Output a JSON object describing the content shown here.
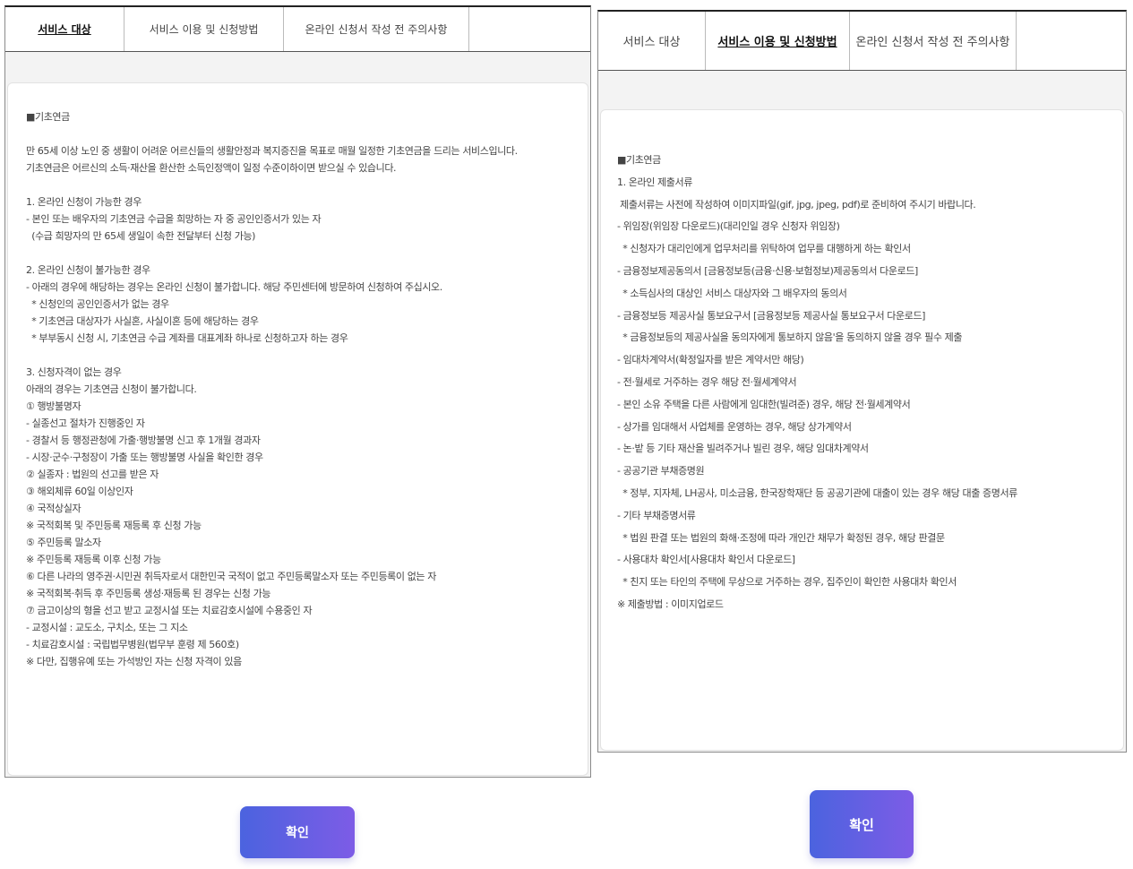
{
  "colors": {
    "accent_start": "#4b63df",
    "accent_end": "#7d5ce6",
    "text": "#444444"
  },
  "tabs": [
    "서비스 대상",
    "서비스 이용 및 신청방법",
    "온라인 신청서 작성 전 주의사항"
  ],
  "left": {
    "active_tab": "서비스 대상",
    "content_lines": [
      "■기초연금",
      "",
      "만 65세 이상 노인 중 생활이 어려운 어르신들의 생활안정과 복지증진을 목표로 매월 일정한 기초연금을 드리는 서비스입니다.",
      "기초연금은 어르신의 소득·재산을 환산한 소득인정액이 일정 수준이하이면 받으실 수 있습니다.",
      "",
      "1. 온라인 신청이 가능한 경우",
      "- 본인 또는 배우자의 기초연금 수급을 희망하는 자 중 공인인증서가 있는 자",
      "  (수급 희망자의 만 65세 생일이 속한 전달부터 신청 가능)",
      "",
      "2. 온라인 신청이 불가능한 경우",
      "- 아래의 경우에 해당하는 경우는 온라인 신청이 불가합니다. 해당 주민센터에 방문하여 신청하여 주십시오.",
      "  * 신청인의 공인인증서가 없는 경우",
      "  * 기초연금 대상자가 사실혼, 사실이혼 등에 해당하는 경우",
      "  * 부부동시 신청 시, 기초연금 수급 계좌를 대표계좌 하나로 신청하고자 하는 경우",
      "",
      "3. 신청자격이 없는 경우",
      "아래의 경우는 기초연금 신청이 불가합니다.",
      "① 행방불명자",
      "- 실종선고 절차가 진행중인 자",
      "- 경찰서 등 행정관청에 가출·행방불명 신고 후 1개월 경과자",
      "- 시장·군수·구청장이 가출 또는 행방불명 사실을 확인한 경우",
      "② 실종자 : 법원의 선고를 받은 자",
      "③ 해외체류 60일 이상인자",
      "④ 국적상실자",
      "※ 국적회복 및 주민등록 재등록 후 신청 가능",
      "⑤ 주민등록 말소자",
      "※ 주민등록 재등록 이후 신청 가능",
      "⑥ 다른 나라의 영주권·시민권 취득자로서 대한민국 국적이 없고 주민등록말소자 또는 주민등록이 없는 자",
      "※ 국적회복·취득 후 주민등록 생성·재등록 된 경우는 신청 가능",
      "⑦ 금고이상의 형을 선고 받고 교정시설 또는 치료감호시설에 수용중인 자",
      "- 교정시설 : 교도소, 구치소, 또는 그 지소",
      "- 치료감호시설 : 국립법무병원(법무부 훈령 제 560호)",
      "※ 다만, 집행유예 또는 가석방인 자는 신청 자격이 있음"
    ],
    "confirm_label": "확인"
  },
  "right": {
    "active_tab": "서비스 이용 및 신청방법",
    "content_lines": [
      "■기초연금",
      "1. 온라인 제출서류",
      " 제출서류는 사전에 작성하여 이미지파일(gif, jpg, jpeg, pdf)로 준비하여 주시기 바랍니다.",
      "- 위임장(위임장 다운로드)(대리인일 경우 신청자 위임장)",
      "  * 신청자가 대리인에게 업무처리를 위탁하여 업무를 대행하게 하는 확인서",
      "- 금융정보제공동의서 [금융정보등(금융·신용·보험정보)제공동의서 다운로드]",
      "  * 소득심사의 대상인 서비스 대상자와 그 배우자의 동의서",
      "- 금융정보등 제공사실 통보요구서 [금융정보등 제공사실 통보요구서 다운로드]",
      "  * 금융정보등의 제공사실을 동의자에게 통보하지 않음'을 동의하지 않을 경우 필수 제출",
      "- 임대차계약서(확정일자를 받은 계약서만 해당)",
      "- 전·월세로 거주하는 경우 해당 전·월세계약서",
      "- 본인 소유 주택을 다른 사람에게 임대한(빌려준) 경우, 해당 전·월세계약서",
      "- 상가를 임대해서 사업체를 운영하는 경우, 해당 상가계약서",
      "- 논·밭 등 기타 재산을 빌려주거나 빌린 경우, 해당 임대차계약서",
      "- 공공기관 부채증명원",
      "  * 정부, 지자체, LH공사, 미소금융, 한국장학재단 등 공공기관에 대출이 있는 경우 해당 대출 증명서류",
      "- 기타 부채증명서류",
      "  * 법원 판결 또는 법원의 화해·조정에 따라 개인간 채무가 확정된 경우, 해당 판결문",
      "- 사용대차 확인서[사용대차 확인서 다운로드]",
      "  * 친지 또는 타인의 주택에 무상으로 거주하는 경우, 집주인이 확인한 사용대차 확인서",
      "※ 제출방법 : 이미지업로드"
    ],
    "confirm_label": "확인"
  }
}
